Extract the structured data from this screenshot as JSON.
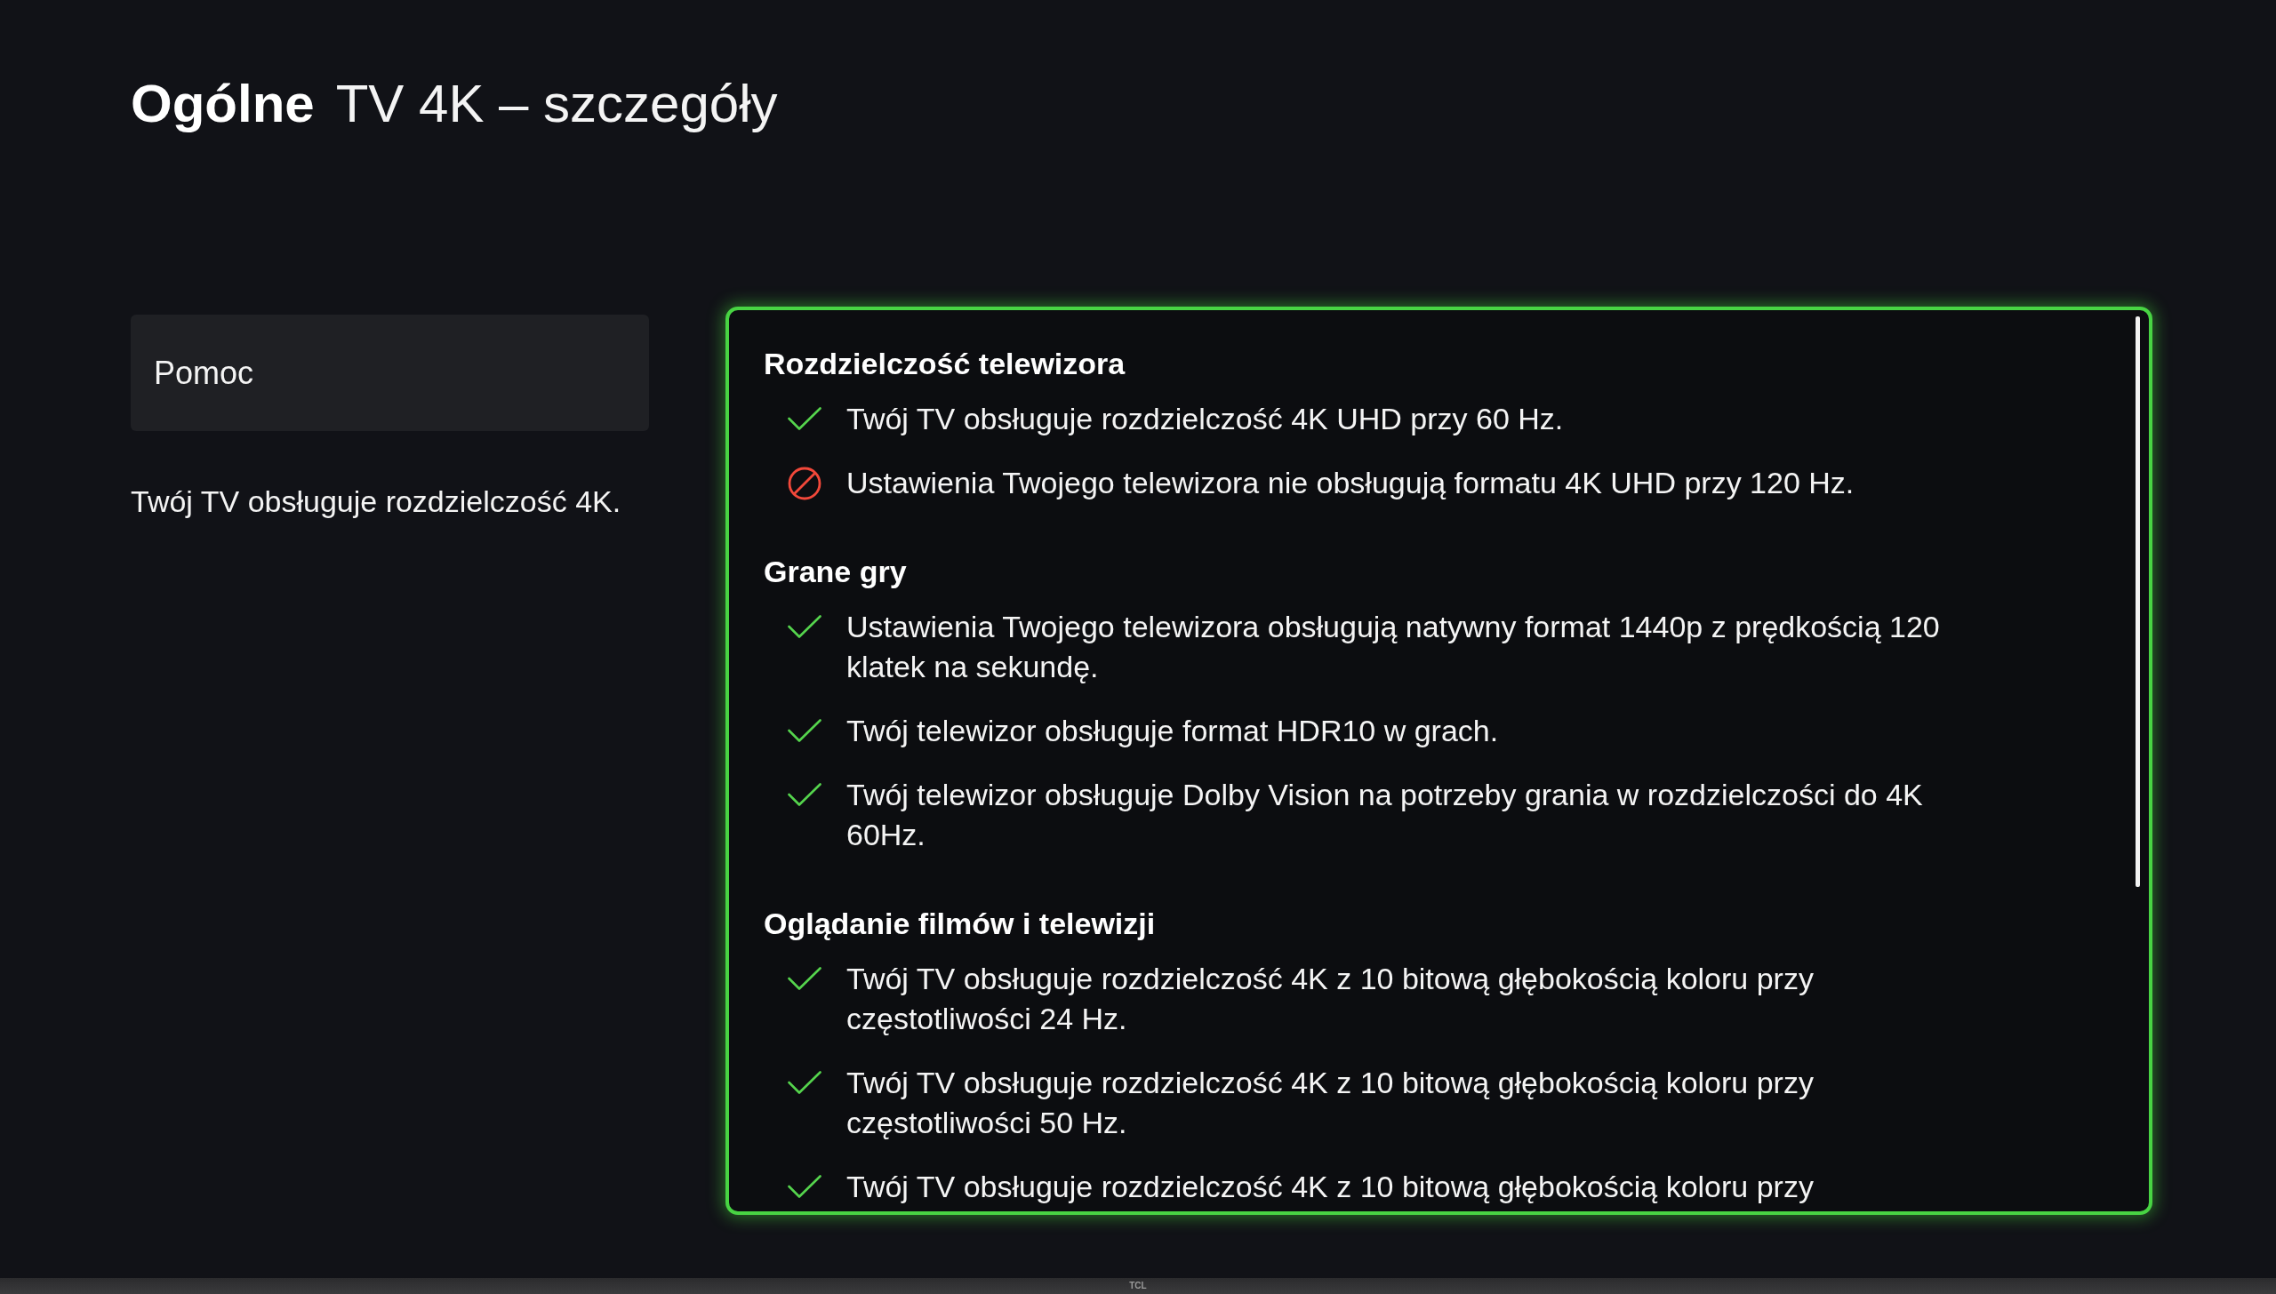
{
  "header": {
    "section": "Ogólne",
    "title": "TV 4K – szczegóły"
  },
  "sidebar": {
    "button": {
      "label": "Pomoc"
    },
    "summary": "Twój TV obsługuje rozdzielczość 4K."
  },
  "details": {
    "focused": true,
    "sections": [
      {
        "heading": "Rozdzielczość telewizora",
        "items": [
          {
            "kind": "supported",
            "text": "Twój TV obsługuje rozdzielczość 4K UHD przy 60 Hz."
          },
          {
            "kind": "unsupported",
            "text": "Ustawienia Twojego telewizora nie obsługują formatu 4K UHD przy 120 Hz."
          }
        ]
      },
      {
        "heading": "Grane gry",
        "items": [
          {
            "kind": "supported",
            "text": "Ustawienia Twojego telewizora obsługują natywny format 1440p z prędkością 120 klatek na sekundę."
          },
          {
            "kind": "supported",
            "text": "Twój telewizor obsługuje format HDR10 w grach."
          },
          {
            "kind": "supported",
            "text": "Twój telewizor obsługuje Dolby Vision na potrzeby grania w rozdzielczości do 4K 60Hz."
          }
        ]
      },
      {
        "heading": "Oglądanie filmów i telewizji",
        "items": [
          {
            "kind": "supported",
            "text": "Twój TV obsługuje rozdzielczość 4K z 10 bitową głębokością koloru przy częstotliwości 24 Hz."
          },
          {
            "kind": "supported",
            "text": "Twój TV obsługuje rozdzielczość 4K z 10 bitową głębokością koloru przy częstotliwości 50 Hz."
          },
          {
            "kind": "supported",
            "text": "Twój TV obsługuje rozdzielczość 4K z 10 bitową głębokością koloru przy"
          }
        ]
      }
    ]
  },
  "bezel": {
    "logo": "TCL"
  }
}
